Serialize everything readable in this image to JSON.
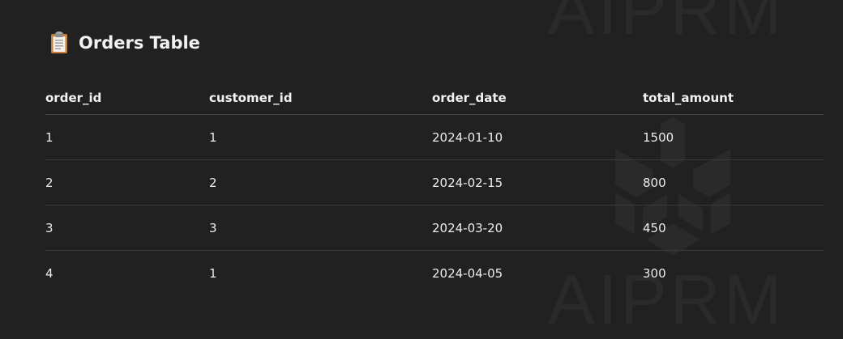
{
  "watermark": {
    "top_text": "AIPRM",
    "bottom_text": "AIPRM"
  },
  "heading": {
    "icon": "clipboard-icon",
    "title": "Orders Table"
  },
  "table": {
    "columns": [
      "order_id",
      "customer_id",
      "order_date",
      "total_amount"
    ],
    "rows": [
      [
        "1",
        "1",
        "2024-01-10",
        "1500"
      ],
      [
        "2",
        "2",
        "2024-02-15",
        "800"
      ],
      [
        "3",
        "3",
        "2024-03-20",
        "450"
      ],
      [
        "4",
        "1",
        "2024-04-05",
        "300"
      ]
    ]
  },
  "colors": {
    "background": "#212121",
    "text": "#ececec",
    "divider": "#3a3a3a",
    "watermark": "#2a2a2a"
  }
}
